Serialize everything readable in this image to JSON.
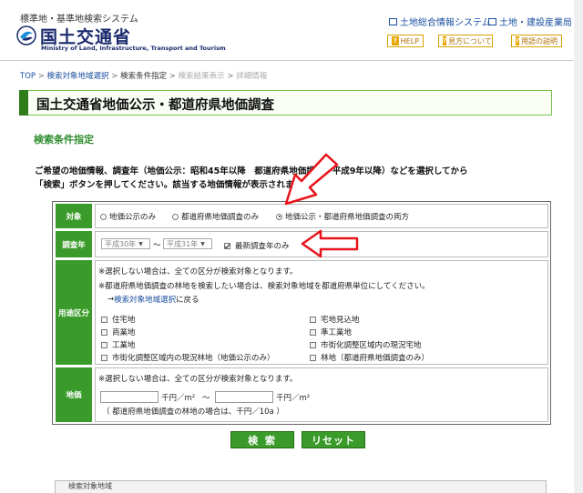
{
  "header": {
    "system_name": "標準地・基準地検索システム",
    "org_name": "国土交通省",
    "org_name_en": "Ministry of Land, Infrastructure, Transport and Tourism",
    "links": [
      "土地総合情報システム",
      "土地・建設産業局"
    ],
    "buttons": [
      "HELP",
      "見方について",
      "用語の説明"
    ]
  },
  "breadcrumb": {
    "top": "TOP",
    "step1": "検索対象地域選択",
    "step2": "検索条件指定",
    "step3": "検索結果表示",
    "step4": "詳細情報",
    "sep": " > "
  },
  "page": {
    "title": "国土交通省地価公示・都道府県地価調査",
    "section": "検索条件指定",
    "intro1": "ご希望の地価情報、調査年（地価公示：昭和45年以降　都道府県地価調査：平成9年以降）などを選択してから",
    "intro2": "「検索」ボタンを押してください。該当する地価情報が表示されます。"
  },
  "form": {
    "target": {
      "label": "対象",
      "options": [
        "地価公示のみ",
        "都道府県地価調査のみ",
        "地価公示・都道府県地価調査の両方"
      ],
      "selected_index": 2
    },
    "year": {
      "label": "調査年",
      "from": "平成30年",
      "tilde": "～",
      "to": "平成31年",
      "latest_label": "最新調査年のみ",
      "latest_checked": true
    },
    "usage": {
      "label": "用途区分",
      "note1": "※選択しない場合は、全ての区分が検索対象となります。",
      "note2": "※都道府県地価調査の林地を検索したい場合は、検索対象地域を都道府県単位にしてください。",
      "back_prefix": "→",
      "back_link": "検索対象地域選択",
      "back_suffix": "に戻る",
      "left": [
        "住宅地",
        "商業地",
        "工業地",
        "市街化調整区域内の現況林地（地価公示のみ）"
      ],
      "right": [
        "宅地見込地",
        "準工業地",
        "市街化調整区域内の現況宅地",
        "林地（都道府県地価調査のみ）"
      ]
    },
    "price": {
      "label": "地価",
      "note": "※選択しない場合は、全ての区分が検索対象となります。",
      "unit": "千円／m²",
      "tilde": "～",
      "note2": "（ 都道府県地価調査の林地の場合は、千円／10a ）"
    }
  },
  "actions": {
    "search": "検 索",
    "reset": "リセット"
  },
  "footer": {
    "region_tab": "検索対象地域"
  },
  "colors": {
    "accent_green": "#3a9b2a",
    "title_green": "#2c8c2c",
    "link_blue": "#1a4fa0",
    "annotation_red": "#e8141c"
  }
}
